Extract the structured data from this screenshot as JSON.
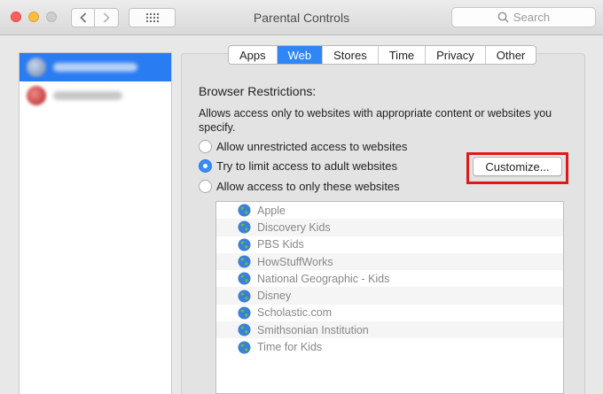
{
  "window": {
    "title": "Parental Controls"
  },
  "search": {
    "placeholder": "Search"
  },
  "tabs": [
    {
      "label": "Apps",
      "active": false
    },
    {
      "label": "Web",
      "active": true
    },
    {
      "label": "Stores",
      "active": false
    },
    {
      "label": "Time",
      "active": false
    },
    {
      "label": "Privacy",
      "active": false
    },
    {
      "label": "Other",
      "active": false
    }
  ],
  "web": {
    "title": "Browser Restrictions:",
    "description": "Allows access only to websites with appropriate content or websites you specify.",
    "options": [
      {
        "label": "Allow unrestricted access to websites",
        "selected": false
      },
      {
        "label": "Try to limit access to adult websites",
        "selected": true
      },
      {
        "label": "Allow access to only these websites",
        "selected": false
      }
    ],
    "customize_label": "Customize...",
    "sites": [
      "Apple",
      "Discovery Kids",
      "PBS Kids",
      "HowStuffWorks",
      "National Geographic - Kids",
      "Disney",
      "Scholastic.com",
      "Smithsonian Institution",
      "Time for Kids"
    ]
  },
  "colors": {
    "accent": "#2f86f6",
    "highlight_border": "#e01818"
  }
}
